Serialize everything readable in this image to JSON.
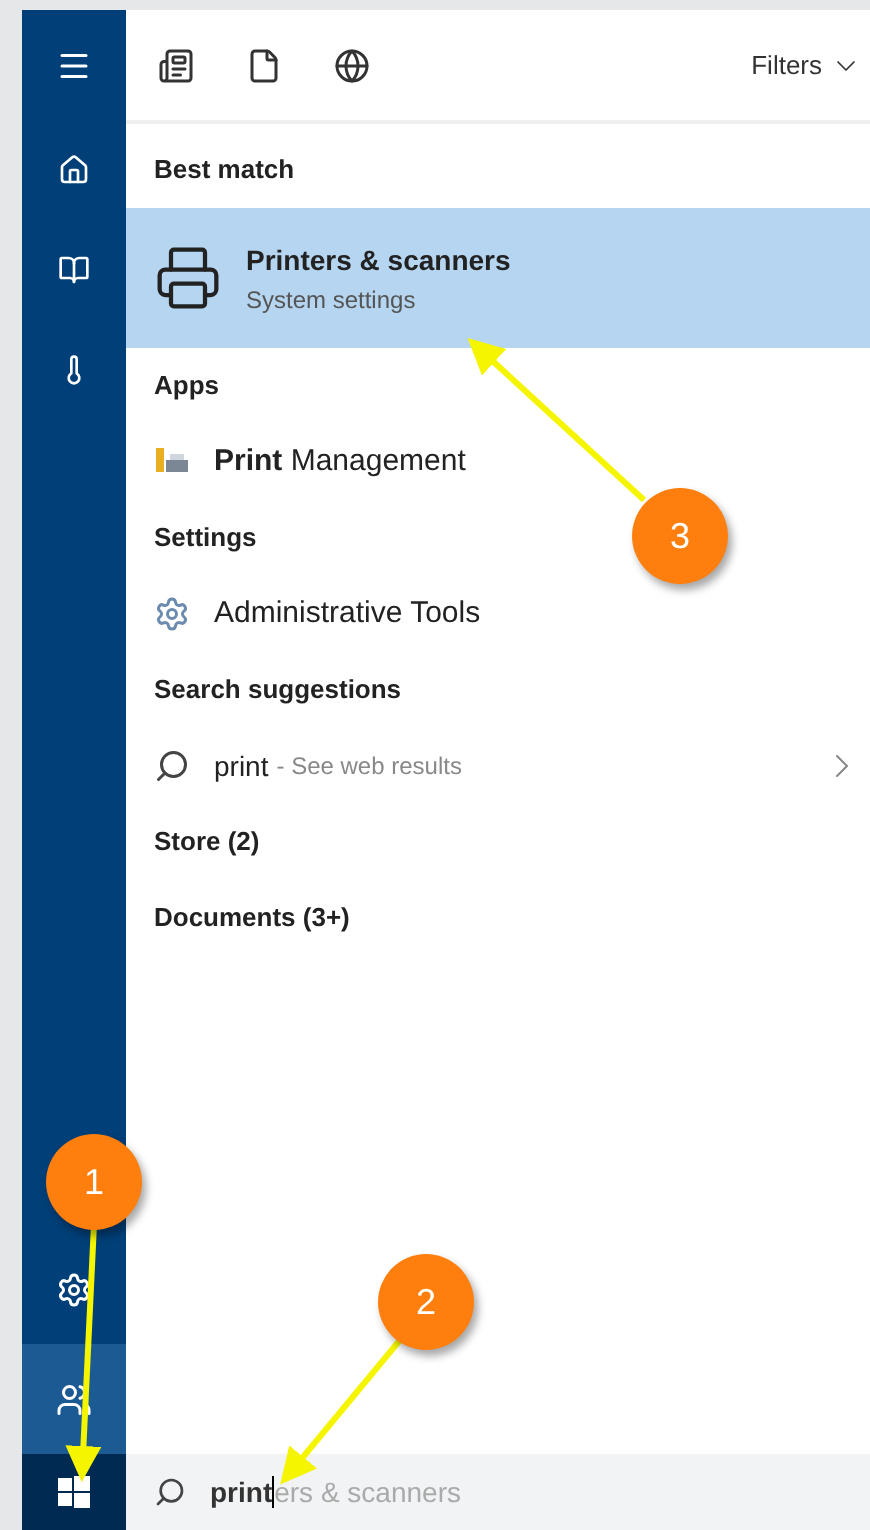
{
  "toolbar": {
    "filters_label": "Filters"
  },
  "sections": [
    {
      "heading": "Best match",
      "items": [
        {
          "kind": "best",
          "title": "Printers & scanners",
          "subtitle": "System settings",
          "selected": true
        }
      ]
    },
    {
      "heading": "Apps",
      "items": [
        {
          "kind": "app",
          "title": "**Print** Management",
          "selected": false
        }
      ]
    },
    {
      "heading": "Settings",
      "items": [
        {
          "kind": "setting",
          "title": "Administrative Tools",
          "selected": false
        }
      ]
    },
    {
      "heading": "Search suggestions",
      "items": [
        {
          "kind": "web",
          "title": "print",
          "subtitle": "- See web results",
          "selected": false
        }
      ]
    },
    {
      "heading": "Store (2)"
    },
    {
      "heading": "Documents (3+)"
    }
  ],
  "search": {
    "value": "print",
    "completion": "ers & scanners"
  },
  "callouts": [
    {
      "label": "1"
    },
    {
      "label": "2"
    },
    {
      "label": "3"
    }
  ]
}
